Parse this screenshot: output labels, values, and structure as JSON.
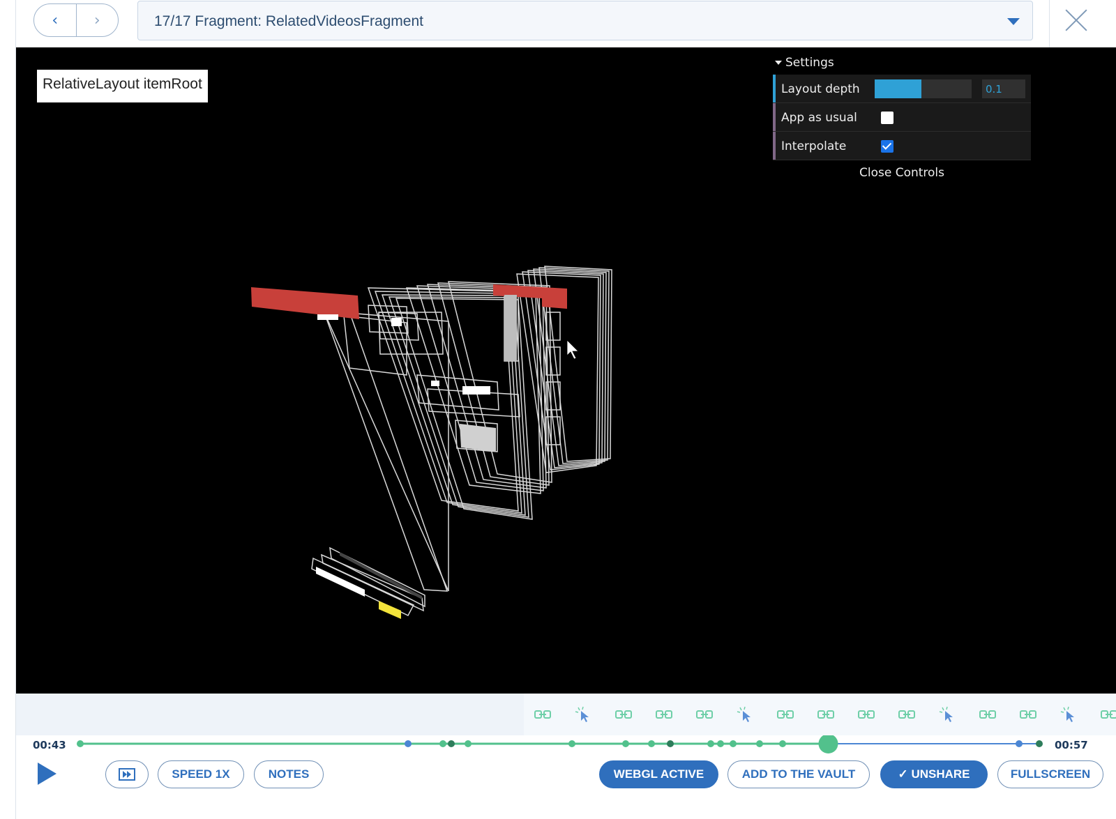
{
  "header": {
    "prev_glyph": "‹",
    "next_glyph": "›",
    "fragment_label": "17/17 Fragment: RelatedVideosFragment"
  },
  "viewer": {
    "tooltip": "RelativeLayout itemRoot"
  },
  "settings": {
    "title": "Settings",
    "layout_depth_label": "Layout depth",
    "layout_depth_value": "0.1",
    "layout_depth_fraction": 0.48,
    "app_as_usual_label": "App as usual",
    "app_as_usual_checked": false,
    "interpolate_label": "Interpolate",
    "interpolate_checked": true,
    "close_label": "Close Controls"
  },
  "events": {
    "icons": [
      "link-icon",
      "cursor-click-icon",
      "link-icon",
      "link-icon",
      "link-icon",
      "cursor-click-icon",
      "link-icon",
      "link-icon",
      "link-icon",
      "link-icon",
      "cursor-click-icon",
      "link-icon",
      "link-icon",
      "cursor-click-icon",
      "link-icon"
    ]
  },
  "timeline": {
    "start_time": "00:43",
    "end_time": "00:57",
    "progress_fraction": 0.78
  },
  "controls": {
    "speed_label": "SPEED 1X",
    "notes_label": "NOTES",
    "webgl_label": "WEBGL ACTIVE",
    "vault_label": "ADD TO THE VAULT",
    "unshare_label": "✓  UNSHARE",
    "fullscreen_label": "FULLSCREEN"
  },
  "colors": {
    "accent": "#2f6fbd",
    "timeline_green": "#52c18c",
    "timeline_blue": "#4b86d4",
    "gui_slider": "#2fa1d6"
  }
}
